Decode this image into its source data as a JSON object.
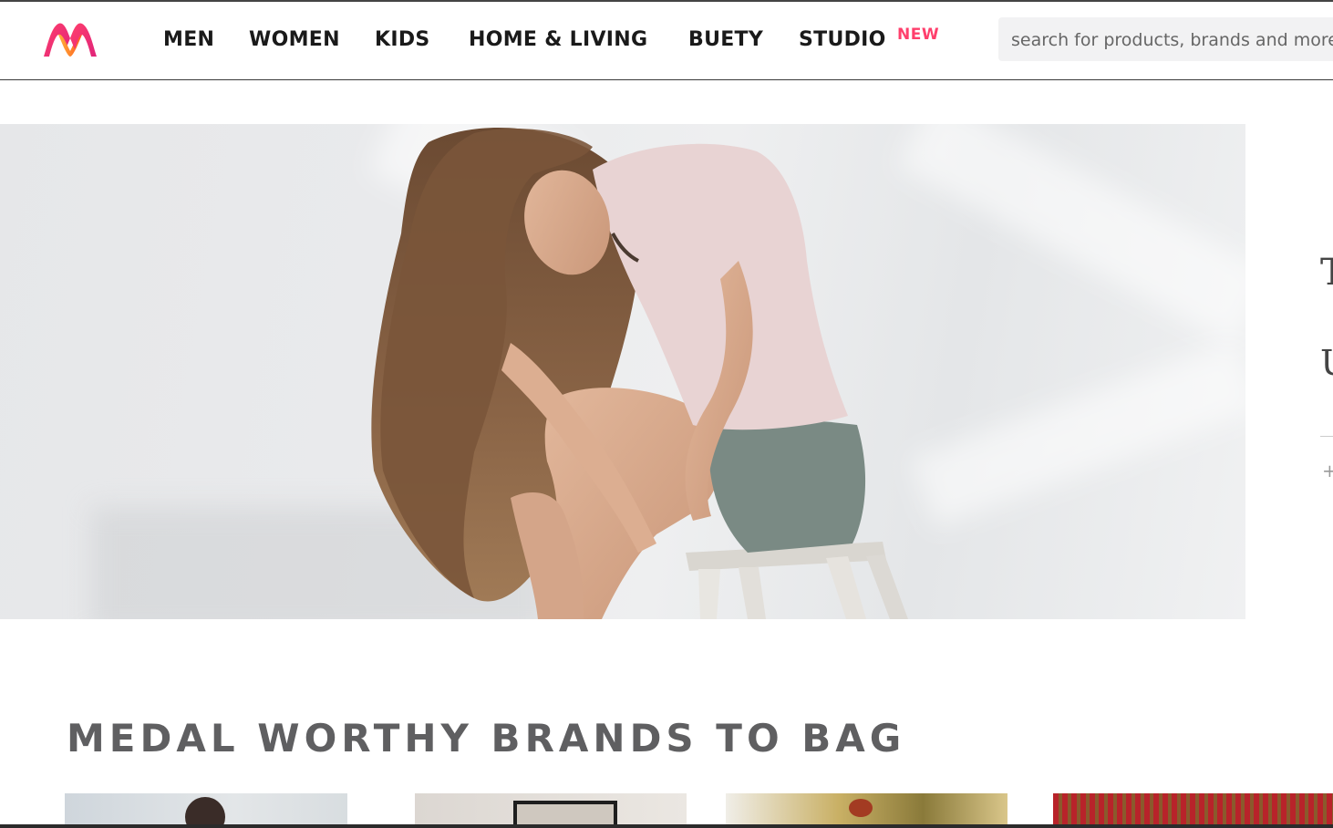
{
  "nav": {
    "items": [
      {
        "label": "MEN"
      },
      {
        "label": "WOMEN"
      },
      {
        "label": "KIDS"
      },
      {
        "label": "HOME & LIVING"
      },
      {
        "label": "BUETY"
      },
      {
        "label": "STUDIO"
      }
    ],
    "studio_badge": "NEW"
  },
  "search": {
    "placeholder": "search for products, brands and more"
  },
  "section": {
    "title": "MEDAL WORTHY BRANDS TO BAG"
  },
  "colors": {
    "accent": "#ff3f6c",
    "logo_orange": "#ff7a1a",
    "logo_pink": "#e0247a"
  }
}
